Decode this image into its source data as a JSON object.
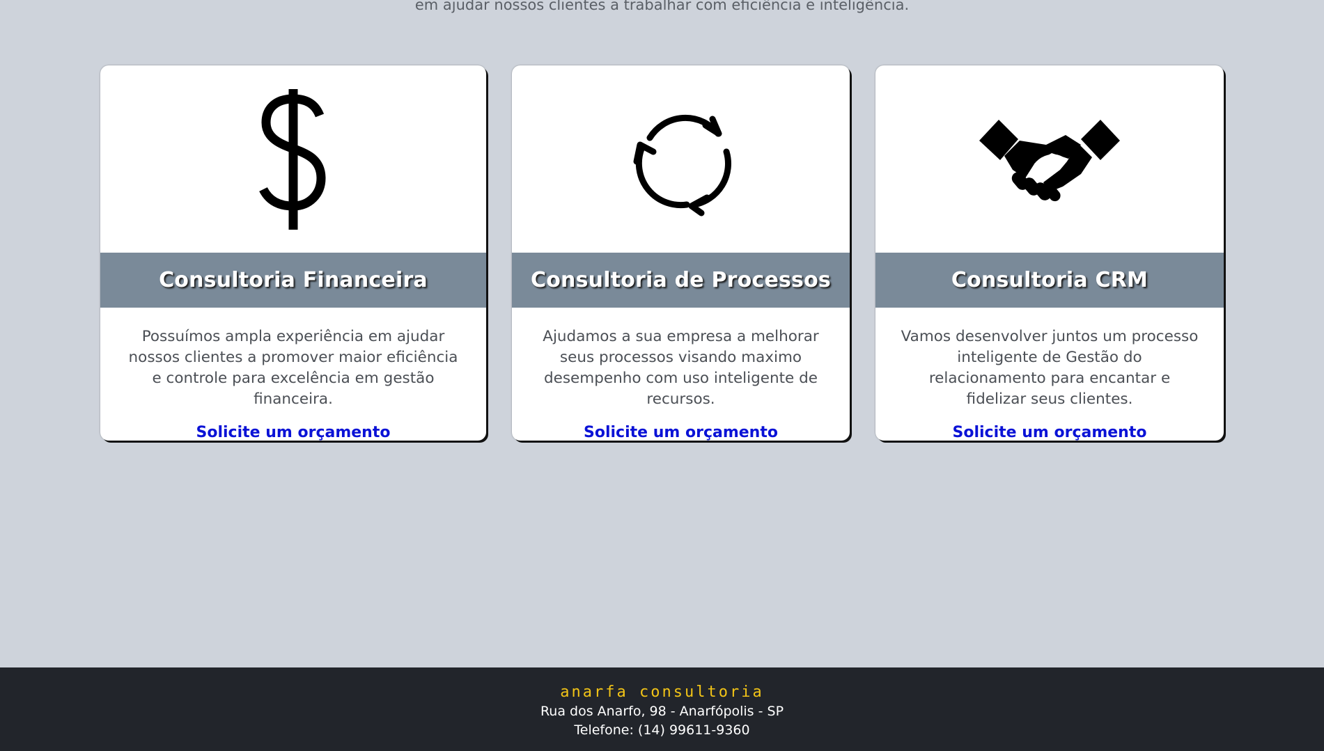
{
  "intro": {
    "text": "em ajudar nossos clientes a trabalhar com eficiência e inteligência."
  },
  "services": [
    {
      "icon": "dollar-icon",
      "title": "Consultoria Financeira",
      "description": "Possuímos ampla experiência em ajudar nossos clientes a promover maior eficiência e controle para excelência em gestão financeira.",
      "link": "Solicite um orçamento"
    },
    {
      "icon": "refresh-cycle-icon",
      "title": "Consultoria de Processos",
      "description": "Ajudamos a sua empresa a melhorar seus processos visando maximo desempenho com uso inteligente de recursos.",
      "link": "Solicite um orçamento"
    },
    {
      "icon": "handshake-icon",
      "title": "Consultoria CRM",
      "description": "Vamos desenvolver juntos um processo inteligente de Gestão do relacionamento para encantar e fidelizar seus clientes.",
      "link": "Solicite um orçamento"
    }
  ],
  "footer": {
    "brand": "Anarfa consultoria",
    "address": "Rua dos Anarfo, 98 - Anarfópolis - SP",
    "phone": "Telefone: (14) 99611-9360"
  },
  "colors": {
    "background": "#ced3db",
    "card_title_bar": "#7a8a99",
    "link": "#0a12d6",
    "footer_background": "#22252b",
    "footer_brand": "#f2c417"
  }
}
